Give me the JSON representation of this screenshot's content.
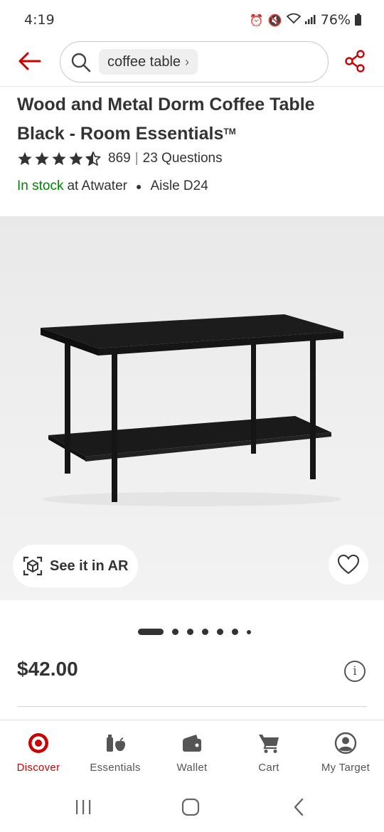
{
  "status_bar": {
    "time": "4:19",
    "battery": "76%"
  },
  "header": {
    "search_chip": "coffee table",
    "chip_chevron": "›"
  },
  "product": {
    "title_line1": "Wood and Metal Dorm Coffee Table",
    "title_line2": "Black - Room Essentials",
    "trademark": "TM",
    "rating": 4.5,
    "review_count": "869",
    "questions": "23 Questions",
    "stock_status": "In stock",
    "store": "at Atwater",
    "aisle": "Aisle D24",
    "price": "$42.00"
  },
  "image_area": {
    "ar_label": "See it in AR",
    "carousel_pages": 7,
    "carousel_active": 0
  },
  "bottom_nav": {
    "items": [
      {
        "label": "Discover",
        "icon": "target-logo-icon",
        "active": true
      },
      {
        "label": "Essentials",
        "icon": "essentials-icon",
        "active": false
      },
      {
        "label": "Wallet",
        "icon": "wallet-icon",
        "active": false
      },
      {
        "label": "Cart",
        "icon": "cart-icon",
        "active": false
      },
      {
        "label": "My Target",
        "icon": "account-icon",
        "active": false
      }
    ]
  },
  "colors": {
    "brand_red": "#cc0000",
    "in_stock_green": "#008300",
    "text": "#333333"
  }
}
